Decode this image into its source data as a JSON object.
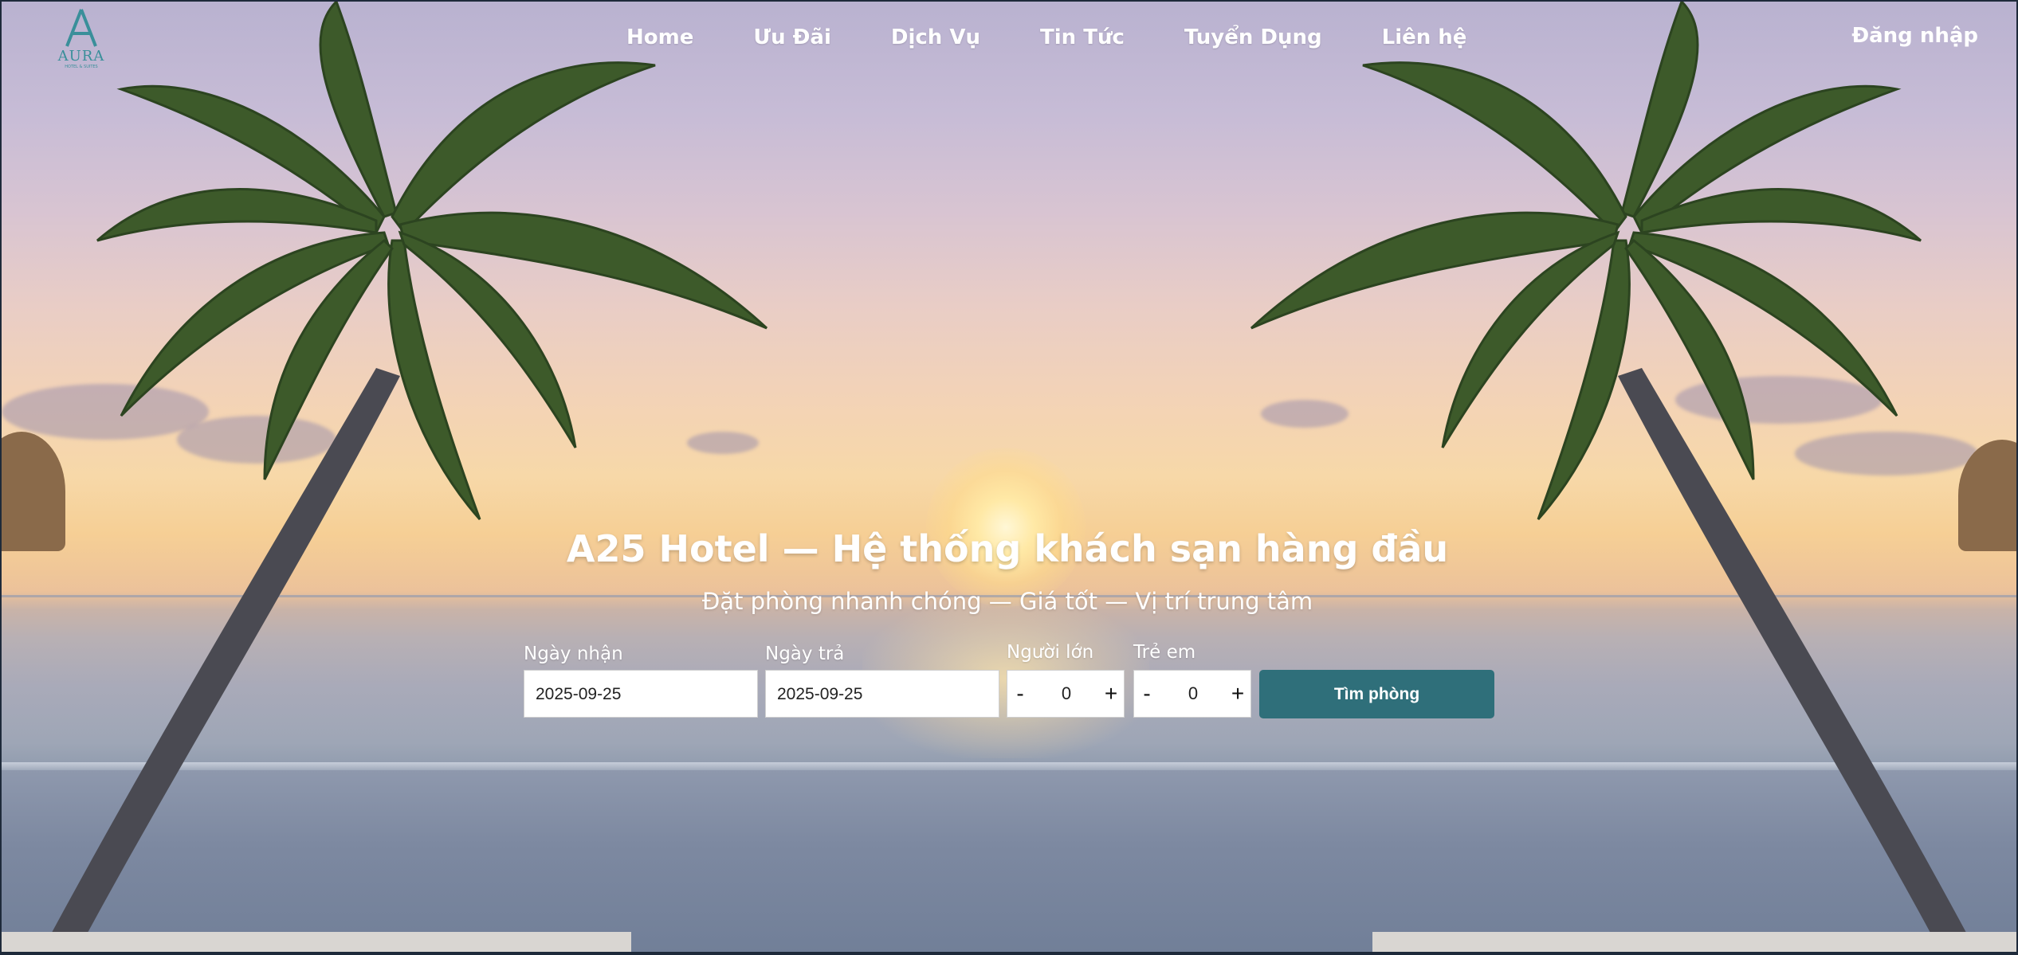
{
  "brand": {
    "logo_text": "AURA",
    "logo_subtext": "HOTEL & SUITES"
  },
  "nav": {
    "items": [
      {
        "label": "Home"
      },
      {
        "label": "Ưu Đãi"
      },
      {
        "label": "Dịch Vụ"
      },
      {
        "label": "Tin Tức"
      },
      {
        "label": "Tuyển Dụng"
      },
      {
        "label": "Liên hệ"
      }
    ],
    "login_label": "Đăng nhập"
  },
  "hero": {
    "title": "A25 Hotel — Hệ thống khách sạn hàng đầu",
    "subtitle": "Đặt phòng nhanh chóng — Giá tốt — Vị trí trung tâm"
  },
  "booking": {
    "checkin": {
      "label": "Ngày nhận",
      "value": "2025-09-25"
    },
    "checkout": {
      "label": "Ngày trả",
      "value": "2025-09-25"
    },
    "adults": {
      "label": "Người lớn",
      "value": "0",
      "minus": "-",
      "plus": "+"
    },
    "children": {
      "label": "Trẻ em",
      "value": "0",
      "minus": "-",
      "plus": "+"
    },
    "search_label": "Tìm phòng"
  },
  "colors": {
    "accent": "#2f6f7a",
    "logo": "#3a8f9a",
    "nav_text": "#ffffff"
  }
}
